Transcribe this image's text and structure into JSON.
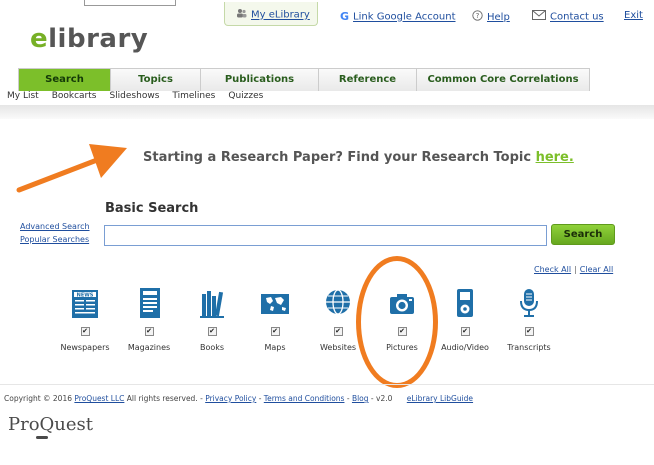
{
  "top": {
    "my_elibrary": "My eLibrary",
    "link_google": "Link Google Account",
    "help": "Help",
    "contact": "Contact us",
    "exit": "Exit"
  },
  "logo": {
    "e": "e",
    "rest": "library"
  },
  "nav": {
    "tabs": [
      "Search",
      "Topics",
      "Publications",
      "Reference",
      "Common Core Correlations"
    ],
    "active": "Search"
  },
  "subnav": [
    "My List",
    "Bookcarts",
    "Slideshows",
    "Timelines",
    "Quizzes"
  ],
  "prompt": {
    "text": "Starting a Research Paper? Find your Research Topic ",
    "link": "here."
  },
  "search": {
    "title": "Basic Search",
    "advanced": "Advanced Search",
    "popular": "Popular Searches",
    "button": "Search",
    "value": "",
    "check_all": "Check All",
    "clear_all": "Clear All"
  },
  "sources": [
    {
      "label": "Newspapers",
      "icon": "newspaper-icon",
      "checked": true
    },
    {
      "label": "Magazines",
      "icon": "magazine-icon",
      "checked": true
    },
    {
      "label": "Books",
      "icon": "books-icon",
      "checked": true
    },
    {
      "label": "Maps",
      "icon": "map-icon",
      "checked": true
    },
    {
      "label": "Websites",
      "icon": "globe-icon",
      "checked": true
    },
    {
      "label": "Pictures",
      "icon": "camera-icon",
      "checked": true
    },
    {
      "label": "Audio/Video",
      "icon": "media-player-icon",
      "checked": true
    },
    {
      "label": "Transcripts",
      "icon": "microphone-icon",
      "checked": true
    }
  ],
  "footer": {
    "copyright": "Copyright © 2016 ",
    "proquest_llc": "ProQuest LLC",
    "rights": " All rights reserved. - ",
    "privacy": "Privacy Policy",
    "dash1": " - ",
    "terms": "Terms and Conditions",
    "dash2": " - ",
    "blog": "Blog",
    "version": " - v2.0",
    "libguide": "eLibrary LibGuide"
  },
  "brand": "ProQuest",
  "colors": {
    "accent_green": "#7cbf2a",
    "link_blue": "#1f4e9e",
    "annotation_orange": "#f07c20",
    "icon_teal": "#1f6fa8"
  }
}
